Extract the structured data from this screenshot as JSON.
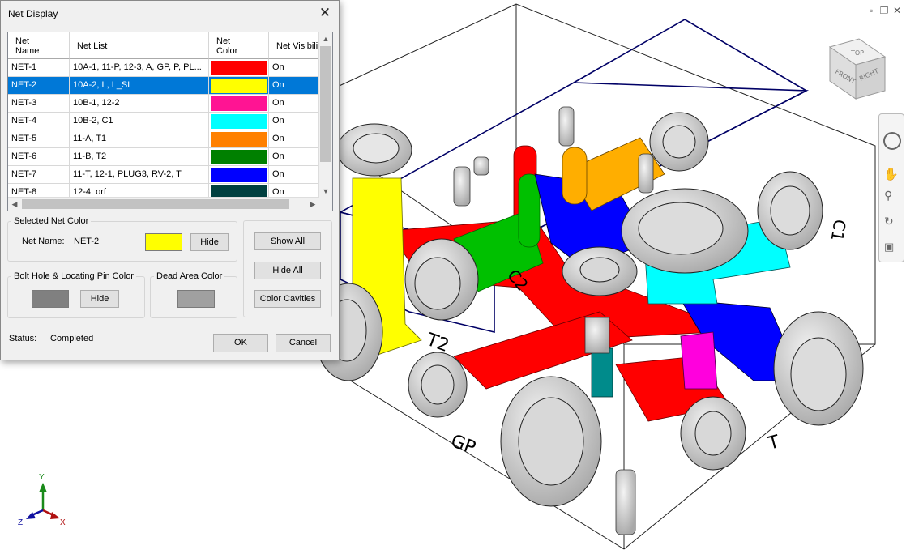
{
  "dialog": {
    "title": "Net Display",
    "columns": [
      "Net\nName",
      "Net List",
      "Net\nColor",
      "Net Visibility"
    ],
    "rows": [
      {
        "name": "NET-1",
        "list": "10A-1, 11-P, 12-3, A, GP, P, PL...",
        "color": "#ff0000",
        "visibility": "On"
      },
      {
        "name": "NET-2",
        "list": "10A-2, L, L_SL",
        "color": "#ffff00",
        "visibility": "On",
        "selected": true
      },
      {
        "name": "NET-3",
        "list": "10B-1, 12-2",
        "color": "#ff1493",
        "visibility": "On"
      },
      {
        "name": "NET-4",
        "list": "10B-2, C1",
        "color": "#00ffff",
        "visibility": "On"
      },
      {
        "name": "NET-5",
        "list": "11-A, T1",
        "color": "#ff8000",
        "visibility": "On"
      },
      {
        "name": "NET-6",
        "list": "11-B, T2",
        "color": "#008000",
        "visibility": "On"
      },
      {
        "name": "NET-7",
        "list": "11-T, 12-1, PLUG3, RV-2, T",
        "color": "#0000ff",
        "visibility": "On"
      },
      {
        "name": "NET-8",
        "list": "12-4. orf",
        "color": "#004040",
        "visibility": "On"
      }
    ],
    "selected_net": {
      "legend": "Selected Net Color",
      "name_label": "Net Name:",
      "name_value": "NET-2",
      "color": "#ffff00",
      "hide_label": "Hide"
    },
    "bolt_hole": {
      "legend": "Bolt Hole & Locating Pin Color",
      "color": "#808080",
      "hide_label": "Hide"
    },
    "dead_area": {
      "legend": "Dead Area Color",
      "color": "#a0a0a0"
    },
    "show_all_label": "Show All",
    "hide_all_label": "Hide All",
    "color_cavities_label": "Color Cavities",
    "status_label": "Status:",
    "status_value": "Completed",
    "ok_label": "OK",
    "cancel_label": "Cancel"
  },
  "viewcube": {
    "top": "TOP",
    "front": "FRONT",
    "right": "RIGHT"
  },
  "port_labels": {
    "t2": "T2",
    "gp": "GP",
    "t": "T",
    "c2": "C2",
    "c1": "C1"
  },
  "triad": {
    "x": "X",
    "y": "Y",
    "z": "Z"
  },
  "navbar_icons": [
    "steering-wheel-icon",
    "pan-icon",
    "zoom-icon",
    "orbit-icon",
    "look-icon"
  ]
}
